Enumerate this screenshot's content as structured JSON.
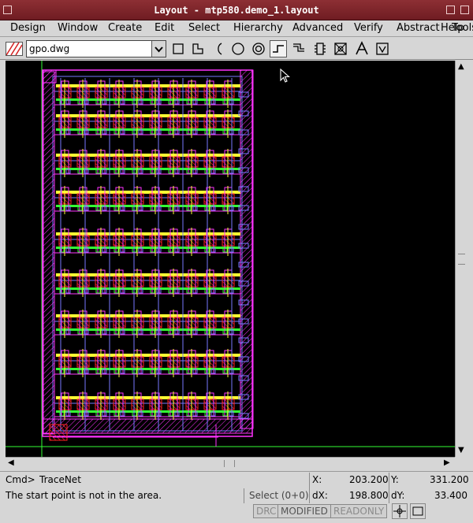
{
  "window": {
    "title": "Layout - mtp580.demo_1.layout"
  },
  "menu": [
    "Design",
    "Window",
    "Create",
    "Edit",
    "Select",
    "Hierarchy",
    "Advanced",
    "Verify",
    "Abstract",
    "Help",
    "Tools"
  ],
  "toolbar": {
    "layer": "gpo.dwg"
  },
  "status": {
    "cmd_label": "Cmd>",
    "cmd_value": "TraceNet",
    "message": "The start point is not in the area.",
    "select": "Select (0+0)",
    "x_label": "X:",
    "x_value": "203.200",
    "y_label": "Y:",
    "y_value": "331.200",
    "dx_label": "dX:",
    "dx_value": "198.800",
    "dy_label": "dY:",
    "dy_value": "33.400",
    "flags": [
      "DRC",
      "MODIFIED",
      "READONLY"
    ]
  },
  "colors": {
    "titlebar": "#7a2128",
    "canvas_bg": "#000000",
    "poly": "#ff2222",
    "metal": "#ffff33",
    "outline": "#ff33ff",
    "diff": "#33ff33",
    "via": "#7777ff"
  }
}
